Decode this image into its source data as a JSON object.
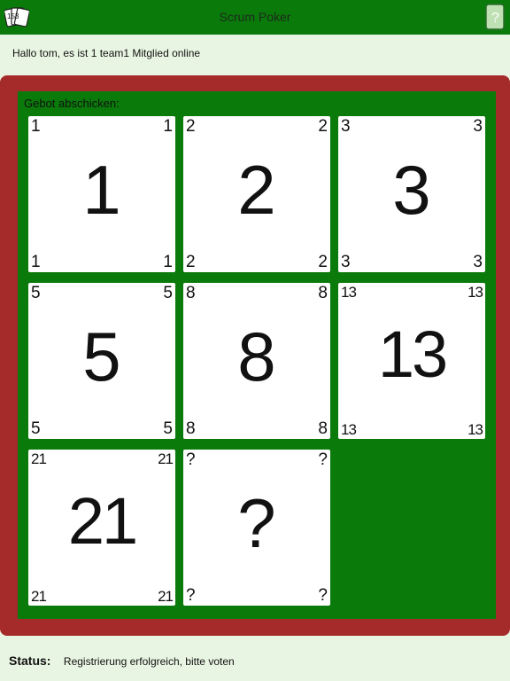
{
  "header": {
    "title": "Scrum Poker",
    "app_icon_text": "153",
    "right_icon_text": "?"
  },
  "greeting": "Hallo tom, es ist 1 team1 Mitglied online",
  "board": {
    "label": "Gebot abschicken:",
    "cards": [
      {
        "value": "1"
      },
      {
        "value": "2"
      },
      {
        "value": "3"
      },
      {
        "value": "5"
      },
      {
        "value": "8"
      },
      {
        "value": "13"
      },
      {
        "value": "21"
      },
      {
        "value": "?"
      }
    ]
  },
  "status": {
    "label": "Status:",
    "text": "Registrierung erfolgreich, bitte voten"
  },
  "colors": {
    "green": "#0a7a0a",
    "red_border": "#a52a2a",
    "background": "#e9f5e3"
  }
}
